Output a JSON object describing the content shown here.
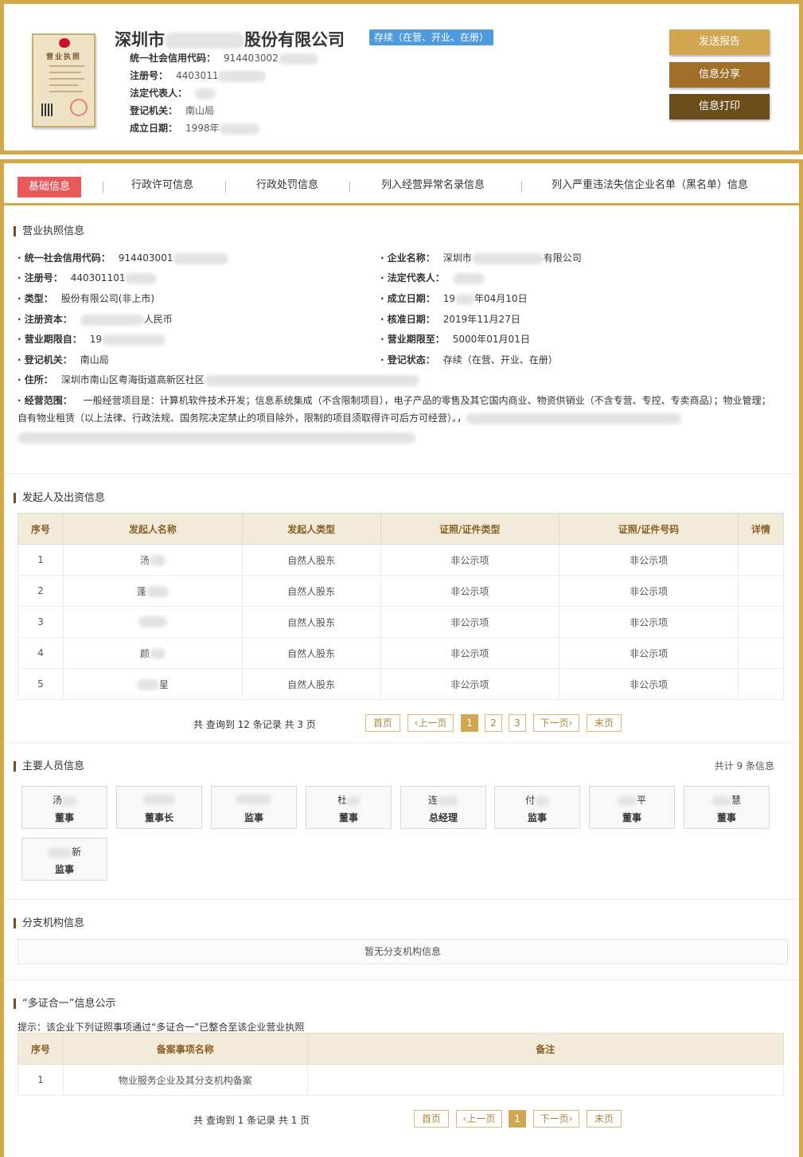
{
  "header": {
    "company_name": "深圳市",
    "company_name_suffix": "股份有限公司",
    "status": "存续（在营、开业、在册）",
    "rows": [
      {
        "label": "统一社会信用代码：",
        "value": "914403002"
      },
      {
        "label": "注册号：",
        "value": "4403011"
      },
      {
        "label": "法定代表人：",
        "value": ""
      },
      {
        "label": "登记机关：",
        "value": "南山局"
      },
      {
        "label": "成立日期：",
        "value": "1998年"
      }
    ],
    "buttons": {
      "send": "发送报告",
      "share": "信息分享",
      "print": "信息打印"
    },
    "license_title": "营业执照"
  },
  "tabs": [
    "基础信息",
    "行政许可信息",
    "行政处罚信息",
    "列入经营异常名录信息",
    "列入严重违法失信企业名单（黑名单）信息"
  ],
  "license_section": {
    "title": "营业执照信息",
    "left": [
      {
        "label": "· 统一社会信用代码：",
        "value": "914403001"
      },
      {
        "label": "· 注册号：",
        "value": "440301101"
      },
      {
        "label": "· 类型：",
        "value": "股份有限公司(非上市)"
      },
      {
        "label": "· 注册资本：",
        "value": "人民币"
      },
      {
        "label": "· 营业期限自：",
        "value": "19"
      },
      {
        "label": "· 登记机关：",
        "value": "南山局"
      },
      {
        "label": "· 住所：",
        "value": "深圳市南山区粤海街道高新区社区"
      }
    ],
    "right": [
      {
        "label": "· 企业名称：",
        "value": "深圳市",
        "value_suffix": "有限公司"
      },
      {
        "label": "· 法定代表人：",
        "value": ""
      },
      {
        "label": "· 成立日期：",
        "value": "19",
        "value_suffix": "年04月10日"
      },
      {
        "label": "· 核准日期：",
        "value": "2019年11月27日"
      },
      {
        "label": "· 营业期限至：",
        "value": "5000年01月01日"
      },
      {
        "label": "· 登记状态：",
        "value": "存续（在营、开业、在册）"
      }
    ],
    "scope_label": "· 经营范围：",
    "scope_text": "一般经营项目是：计算机软件技术开发；信息系统集成（不含限制项目），电子产品的零售及其它国内商业、物资供销业（不含专营、专控、专卖商品）；物业管理；自有物业租赁（以上法律、行政法规、国务院决定禁止的项目除外，限制的项目须取得许可后方可经营）。，"
  },
  "investors": {
    "title": "发起人及出资信息",
    "columns": [
      "序号",
      "发起人名称",
      "发起人类型",
      "证照/证件类型",
      "证照/证件号码",
      "详情"
    ],
    "rows": [
      {
        "no": "1",
        "name": "汤",
        "type": "自然人股东",
        "cert_type": "非公示项",
        "cert_no": "非公示项"
      },
      {
        "no": "2",
        "name": "蓬",
        "type": "自然人股东",
        "cert_type": "非公示项",
        "cert_no": "非公示项"
      },
      {
        "no": "3",
        "name": "",
        "type": "自然人股东",
        "cert_type": "非公示项",
        "cert_no": "非公示项"
      },
      {
        "no": "4",
        "name": "颜",
        "type": "自然人股东",
        "cert_type": "非公示项",
        "cert_no": "非公示项"
      },
      {
        "no": "5",
        "name": "星",
        "type": "自然人股东",
        "cert_type": "非公示项",
        "cert_no": "非公示项"
      }
    ],
    "pager": {
      "summary": "共 查询到 12 条记录 共 3 页",
      "first": "首页",
      "prev": "‹上一页",
      "pages": [
        "1",
        "2",
        "3"
      ],
      "next": "下一页›",
      "last": "末页"
    }
  },
  "personnel": {
    "title": "主要人员信息",
    "total": "共计 9 条信息",
    "people": [
      {
        "name": "汤",
        "role": "董事"
      },
      {
        "name": "",
        "role": "董事长"
      },
      {
        "name": "",
        "role": "监事"
      },
      {
        "name": "杜",
        "role": "董事"
      },
      {
        "name": "连",
        "role": "总经理"
      },
      {
        "name": "付",
        "role": "监事"
      },
      {
        "name": "平",
        "role": "董事"
      },
      {
        "name": "慧",
        "role": "董事"
      },
      {
        "name": "新",
        "role": "监事"
      }
    ]
  },
  "branches": {
    "title": "分支机构信息",
    "empty": "暂无分支机构信息"
  },
  "multi_cert": {
    "title": "“多证合一”信息公示",
    "tip": "提示：该企业下列证照事项通过“多证合一”已整合至该企业营业执照",
    "columns": [
      "序号",
      "备案事项名称",
      "备注"
    ],
    "rows": [
      {
        "no": "1",
        "name": "物业服务企业及其分支机构备案",
        "note": ""
      }
    ],
    "pager": {
      "summary": "共 查询到 1 条记录 共 1 页",
      "first": "首页",
      "prev": "‹上一页",
      "pages": [
        "1"
      ],
      "next": "下一页›",
      "last": "末页"
    }
  },
  "colors": {
    "gold": "#d1a84a",
    "tab_active": "#e8575a",
    "status_blue": "#4f99dd",
    "table_header": "#f3ebda"
  }
}
